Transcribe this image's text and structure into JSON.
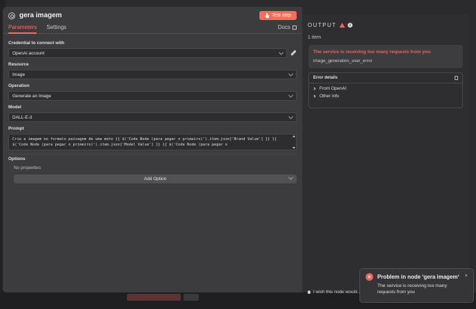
{
  "node": {
    "title": "gera imagem",
    "test_step_label": "Test step"
  },
  "tabs": [
    {
      "label": "Parameters"
    },
    {
      "label": "Settings"
    }
  ],
  "docs_label": "Docs",
  "fields": {
    "credential_label": "Credential to connect with",
    "credential_value": "OpenAi account",
    "resource_label": "Resource",
    "resource_value": "Image",
    "operation_label": "Operation",
    "operation_value": "Generate an Image",
    "model_label": "Model",
    "model_value": "DALL-E-3",
    "prompt_label": "Prompt",
    "prompt_line1": "Crie a imagem no formato paisagem de uma moto {{ $('Code Node (para pegar o primeiro)').item.json['Brand Value'] }} {{",
    "prompt_line2": "$('Code Node (para pegar o primeiro)').item.json['Model Value'] }} {{ $('Code Node (para pegar o",
    "options_label": "Options",
    "no_properties": "No properties",
    "add_option_label": "Add Option"
  },
  "output": {
    "title": "OUTPUT",
    "item_count": "1 item",
    "error_title": "The service is receiving too many requests from you",
    "error_code": "image_generation_user_error",
    "details_title": "Error details",
    "details_rows": [
      "From OpenAI",
      "Other info"
    ]
  },
  "wish_text": "I wish this node would...",
  "toast": {
    "title": "Problem in node ‘gera imagem‘",
    "message": "The service is receiving too many requests from you",
    "close": "×"
  },
  "colors": {
    "accent": "#ff6d5a",
    "error": "#f0625a",
    "panel_bg": "#3c3c3e",
    "output_bg": "#2e2e30"
  },
  "icons": {
    "node": "openai-icon",
    "test": "flask-icon",
    "docs": "external-link-icon",
    "credential_edit": "pencil-icon",
    "output_warning": "warning-icon",
    "output_info": "info-icon",
    "details_copy": "copy-icon",
    "wish": "lightbulb-icon",
    "toast_error": "error-icon"
  }
}
